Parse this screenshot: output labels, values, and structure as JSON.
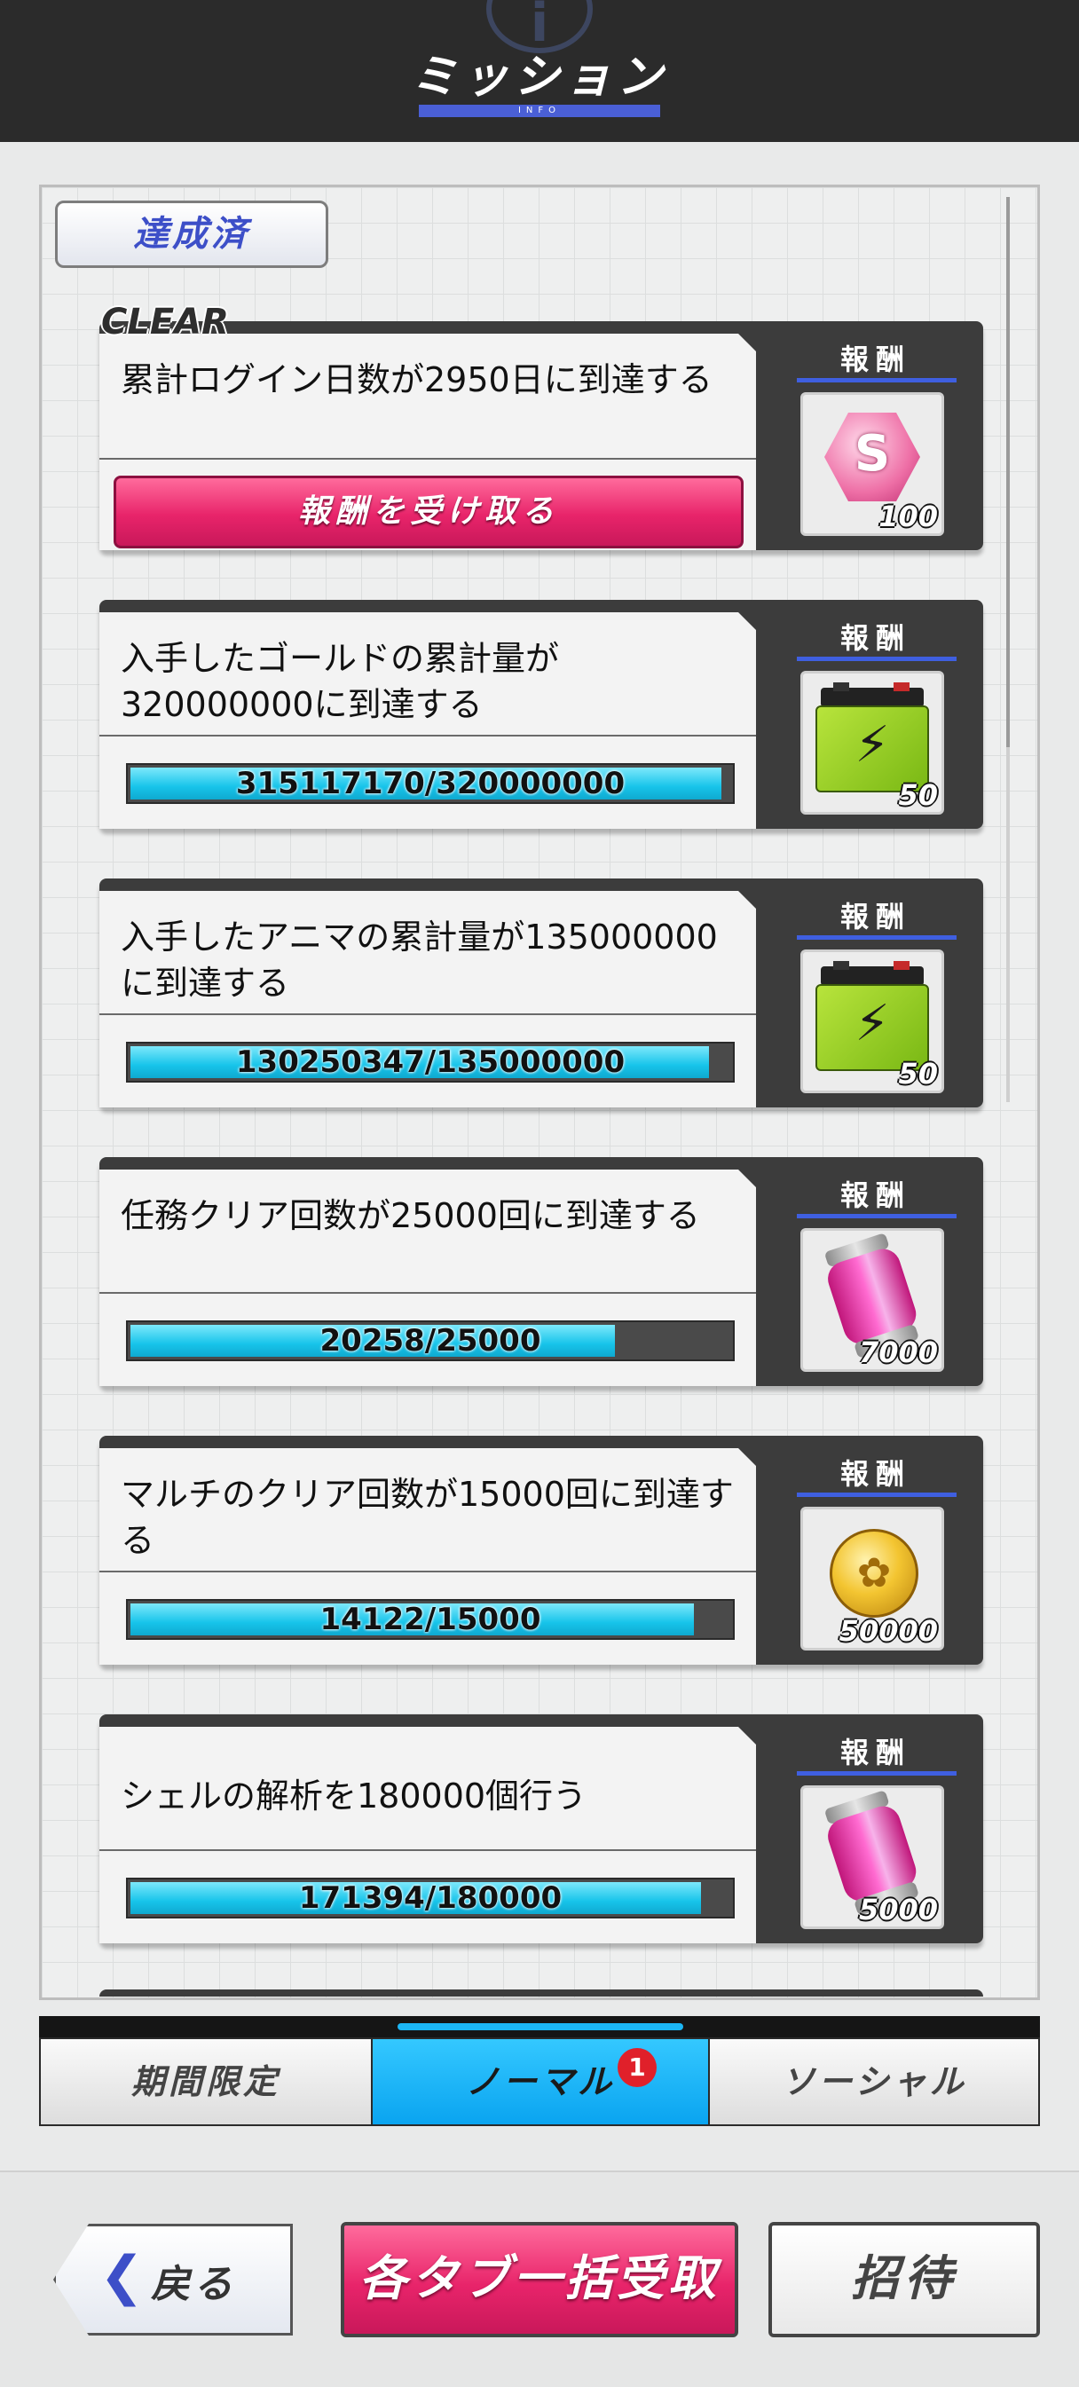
{
  "header": {
    "info_icon": "i",
    "title": "ミッション",
    "subtitle": "INFO"
  },
  "section": {
    "label": "達成済"
  },
  "reward_label": "報酬",
  "missions": [
    {
      "badge": "CLEAR",
      "title": "累計ログイン日数が2950日に到達する",
      "button_label": "報酬を受け取る",
      "reward_icon": "gem-icon",
      "reward_icon_text": "S",
      "reward_count": "100"
    },
    {
      "title": "入手したゴールドの累計量が320000000に到達する",
      "progress_text": "315117170/320000000",
      "progress_fraction": 0.985,
      "reward_icon": "battery-icon",
      "reward_count": "50"
    },
    {
      "title": "入手したアニマの累計量が135000000に到達する",
      "progress_text": "130250347/135000000",
      "progress_fraction": 0.965,
      "reward_icon": "battery-icon",
      "reward_count": "50"
    },
    {
      "title": "任務クリア回数が25000回に到達する",
      "progress_text": "20258/25000",
      "progress_fraction": 0.81,
      "reward_icon": "capsule-icon",
      "reward_count": "7000"
    },
    {
      "title": "マルチのクリア回数が15000回に到達する",
      "progress_text": "14122/15000",
      "progress_fraction": 0.94,
      "reward_icon": "coin-icon",
      "reward_count": "50000"
    },
    {
      "title": "シェルの解析を180000個行う",
      "progress_text": "171394/180000",
      "progress_fraction": 0.952,
      "reward_icon": "capsule-icon",
      "reward_count": "5000"
    }
  ],
  "tabs": [
    {
      "label": "期間限定",
      "active": false
    },
    {
      "label": "ノーマル",
      "active": true,
      "badge": "1"
    },
    {
      "label": "ソーシャル",
      "active": false
    }
  ],
  "buttons": {
    "back": "戻る",
    "bulk_claim": "各タブ一括受取",
    "invite": "招待"
  },
  "colors": {
    "accent_blue": "#4a5fd6",
    "claim_pink": "#e8246a",
    "progress_cyan": "#17c4ea",
    "tab_active": "#0aa4f0"
  }
}
